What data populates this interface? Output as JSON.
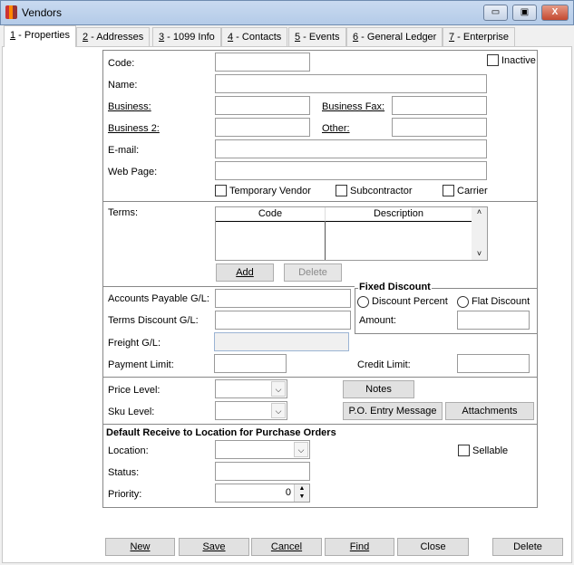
{
  "window": {
    "title": "Vendors",
    "minimize": "▭",
    "maximize": "▣",
    "close": "X"
  },
  "tabs": [
    {
      "key": "1",
      "label": " - Properties"
    },
    {
      "key": "2",
      "label": " - Addresses"
    },
    {
      "key": "3",
      "label": " - 1099 Info"
    },
    {
      "key": "4",
      "label": " - Contacts"
    },
    {
      "key": "5",
      "label": " - Events"
    },
    {
      "key": "6",
      "label": " - General Ledger"
    },
    {
      "key": "7",
      "label": " - Enterprise"
    }
  ],
  "general": {
    "code": "Code:",
    "inactive": "Inactive",
    "name": "Name:",
    "business": "Business:",
    "business_fax": "Business Fax:",
    "business2": "Business 2:",
    "other": "Other:",
    "email": "E-mail:",
    "web_page": "Web Page:",
    "temporary_vendor": "Temporary Vendor",
    "subcontractor": "Subcontractor",
    "carrier": "Carrier"
  },
  "terms": {
    "label": "Terms:",
    "columns": [
      "Code",
      "Description"
    ],
    "add": "Add",
    "delete": "Delete"
  },
  "gl": {
    "ap": "Accounts Payable G/L:",
    "terms_discount": "Terms Discount G/L:",
    "freight": "Freight G/L:",
    "payment_limit": "Payment Limit:",
    "credit_limit": "Credit Limit:"
  },
  "fixed_discount": {
    "title": "Fixed Discount",
    "percent": "Discount Percent",
    "flat": "Flat Discount",
    "amount": "Amount:"
  },
  "pricing": {
    "price_level": "Price Level:",
    "sku_level": "Sku Level:",
    "notes": "Notes",
    "po_entry": "P.O. Entry Message",
    "attachments": "Attachments"
  },
  "receive": {
    "title": "Default Receive to Location for Purchase Orders",
    "location": "Location:",
    "sellable": "Sellable",
    "status": "Status:",
    "priority": "Priority:",
    "priority_value": "0"
  },
  "footer": {
    "new": "New",
    "save": "Save",
    "cancel": "Cancel",
    "find": "Find",
    "close": "Close",
    "delete": "Delete"
  }
}
